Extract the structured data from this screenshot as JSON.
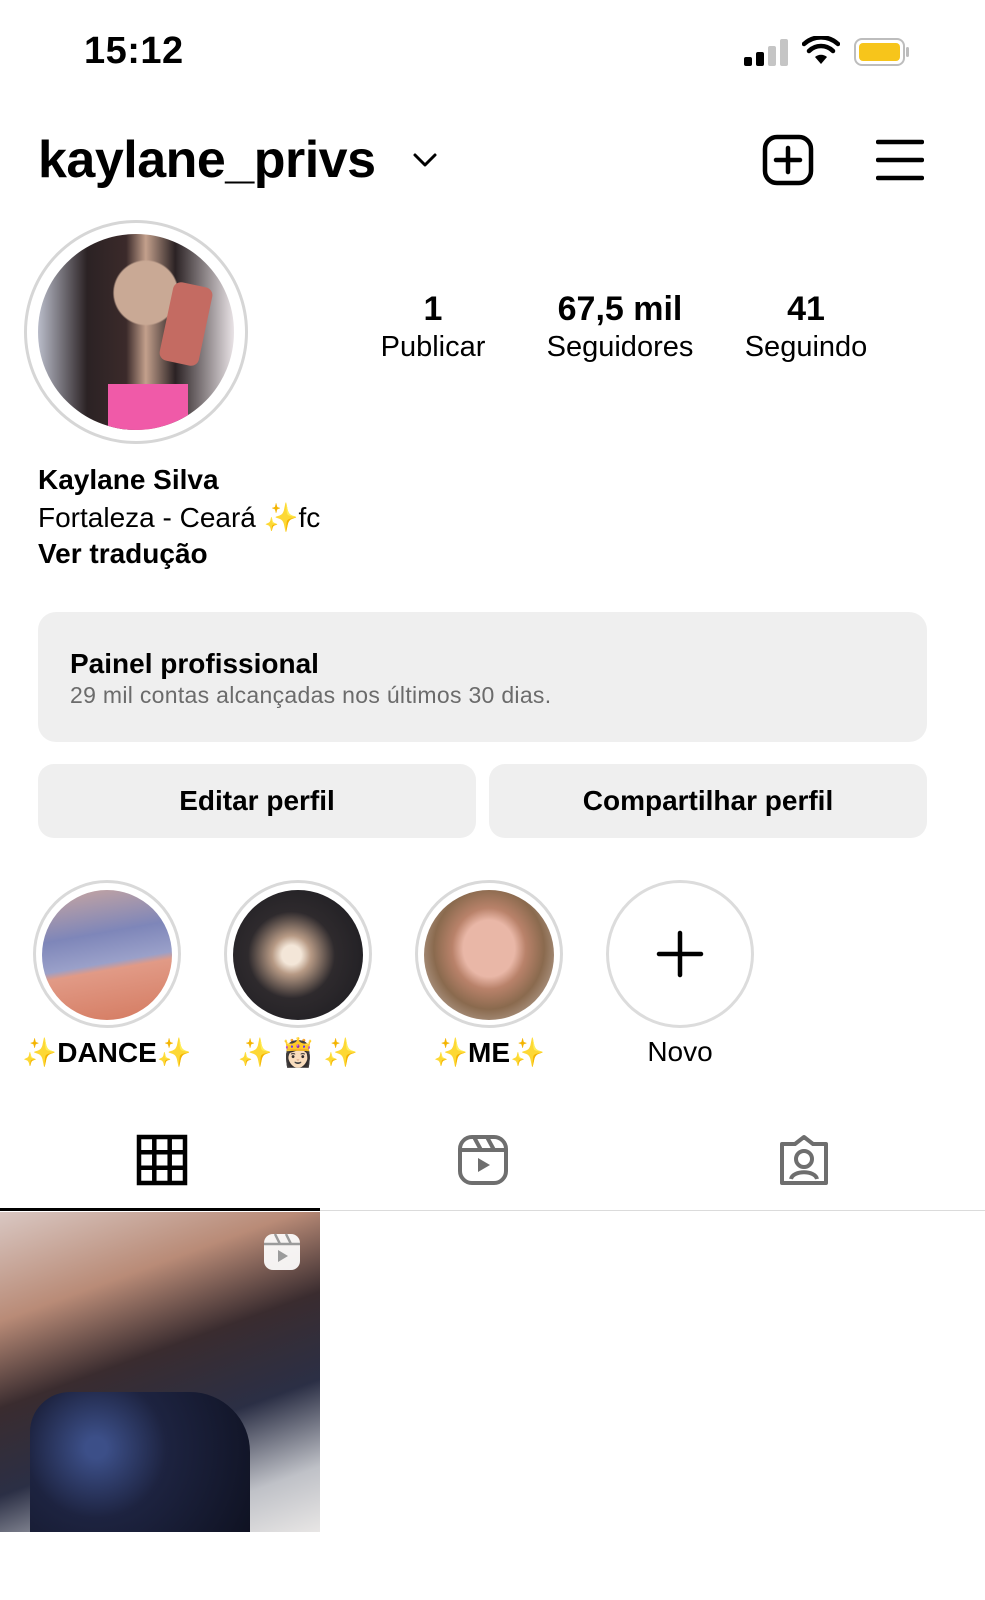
{
  "status_bar": {
    "time": "15:12"
  },
  "header": {
    "username": "kaylane_privs"
  },
  "stats": [
    {
      "value": "1",
      "label": "Publicar"
    },
    {
      "value": "67,5 mil",
      "label": "Seguidores"
    },
    {
      "value": "41",
      "label": "Seguindo"
    }
  ],
  "bio": {
    "name": "Kaylane Silva",
    "line_prefix": "Fortaleza - Ceará ",
    "line_emoji": "✨",
    "line_suffix": "fc",
    "translate": "Ver tradução"
  },
  "panel": {
    "title": "Painel profissional",
    "subtitle": "29 mil contas alcançadas nos últimos 30 dias."
  },
  "buttons": {
    "edit": "Editar perfil",
    "share": "Compartilhar perfil"
  },
  "highlights": [
    {
      "pre": "✨",
      "text": "DANCE",
      "post": "✨"
    },
    {
      "pre": "✨ ",
      "text": "👸🏻",
      "post": " ✨"
    },
    {
      "pre": "✨",
      "text": "ME",
      "post": "✨"
    },
    {
      "pre": "",
      "text": "Novo",
      "post": ""
    }
  ],
  "colors": {
    "battery": "#f7c51b",
    "panel_bg": "#efefef",
    "sparkle": "#f3c63f"
  }
}
